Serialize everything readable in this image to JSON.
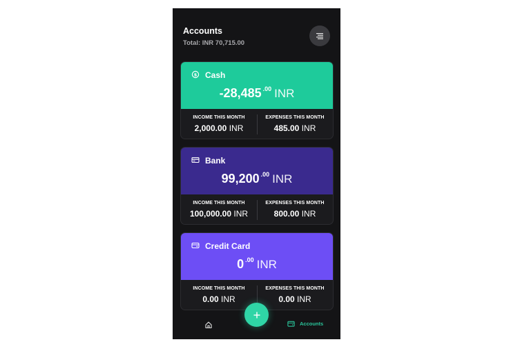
{
  "header": {
    "title": "Accounts",
    "total": "Total: INR 70,715.00"
  },
  "accounts": [
    {
      "name": "Cash",
      "icon": "dollar-coin-icon",
      "color": "#1ecb9b",
      "amount_main": "-28,485",
      "amount_decimal": ".00",
      "currency": "INR",
      "income_label": "INCOME THIS MONTH",
      "income_value": "2,000.00",
      "income_currency": "INR",
      "expense_label": "EXPENSES THIS MONTH",
      "expense_value": "485.00",
      "expense_currency": "INR"
    },
    {
      "name": "Bank",
      "icon": "bank-card-icon",
      "color": "#3a2a8e",
      "amount_main": "99,200",
      "amount_decimal": ".00",
      "currency": "INR",
      "income_label": "INCOME THIS MONTH",
      "income_value": "100,000.00",
      "income_currency": "INR",
      "expense_label": "EXPENSES THIS MONTH",
      "expense_value": "800.00",
      "expense_currency": "INR"
    },
    {
      "name": "Credit Card",
      "icon": "credit-card-icon",
      "color": "#6d4ef5",
      "amount_main": "0",
      "amount_decimal": ".00",
      "currency": "INR",
      "income_label": "INCOME THIS MONTH",
      "income_value": "0.00",
      "income_currency": "INR",
      "expense_label": "EXPENSES THIS MONTH",
      "expense_value": "0.00",
      "expense_currency": "INR"
    }
  ],
  "nav": {
    "accounts_label": "Accounts",
    "active_color": "#2ac49a"
  },
  "fab": {
    "label": "+",
    "color": "#2fd5a6"
  }
}
